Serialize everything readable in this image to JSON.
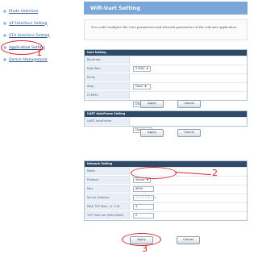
{
  "sidebar": {
    "items": [
      {
        "label": "Mode Selection",
        "active": false
      },
      {
        "label": "AP Interface Setting",
        "active": false
      },
      {
        "label": "STA Interface Setting",
        "active": false
      },
      {
        "label": "Application Setting",
        "active": true
      },
      {
        "label": "Device Management",
        "active": false
      }
    ]
  },
  "page": {
    "title": "Wifi-Uart Setting",
    "description": "You could configure the Uart parameters and network parameters of the wifi-uart application."
  },
  "uart": {
    "header": "Uart Setting",
    "rows": [
      {
        "label": "Baudrate",
        "value": "57600"
      },
      {
        "label": "Data Bits",
        "value": "8"
      },
      {
        "label": "Parity",
        "value": "None"
      },
      {
        "label": "Stop",
        "value": "1"
      },
      {
        "label": "CTSRTS",
        "value": "Disable"
      }
    ],
    "apply": "Apply",
    "cancel": "Cancel"
  },
  "autoframe": {
    "header": "UART AutoFrame Setting",
    "rows": [
      {
        "label": "UART AutoFrame",
        "value": "Disable"
      }
    ],
    "apply": "Apply",
    "cancel": "Cancel"
  },
  "network": {
    "header": "Network Setting",
    "rows": [
      {
        "label": "Mode",
        "value": "Server"
      },
      {
        "label": "Protocol",
        "value": "TCP"
      },
      {
        "label": "Port",
        "value": "8899"
      },
      {
        "label": "Server Address",
        "value": "10.10.100.100"
      },
      {
        "label": "MAX TCP Num. (1~24)",
        "value": "3"
      },
      {
        "label": "TCP Time out (MAX 600s)",
        "value": "0"
      }
    ],
    "apply": "Apply",
    "cancel": "Cancel"
  },
  "annotations": {
    "n1": "1",
    "n2": "2",
    "n3": "3"
  },
  "colors": {
    "annotation": "#d8262a",
    "title_bar": "#7aa7d6",
    "section_header": "#2f4a66"
  }
}
